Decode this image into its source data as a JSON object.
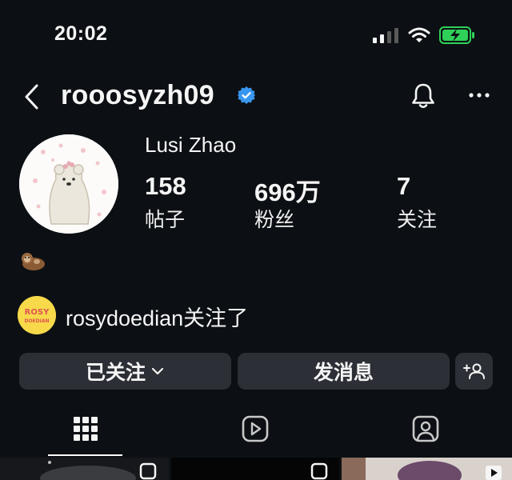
{
  "status_bar": {
    "time": "20:02"
  },
  "header": {
    "username": "rooosyzh09"
  },
  "profile": {
    "full_name": "Lusi Zhao",
    "stats": [
      {
        "value": "158",
        "label": "帖子"
      },
      {
        "value": "696万",
        "label": "粉丝"
      },
      {
        "value": "7",
        "label": "关注"
      }
    ],
    "followed_by": {
      "avatar_text_1": "ROSY",
      "avatar_text_2": "DOEDIAN",
      "name": "rosydoedian",
      "suffix": "关注了"
    }
  },
  "actions": {
    "following_label": "已关注",
    "message_label": "发消息"
  },
  "tabs": [
    {
      "name": "grid-icon",
      "active": true
    },
    {
      "name": "reels-icon",
      "active": false
    },
    {
      "name": "tagged-icon",
      "active": false
    }
  ],
  "colors": {
    "background": "#0c1014",
    "verified": "#3897f0",
    "button": "#2c3036",
    "battery": "#30d158"
  }
}
